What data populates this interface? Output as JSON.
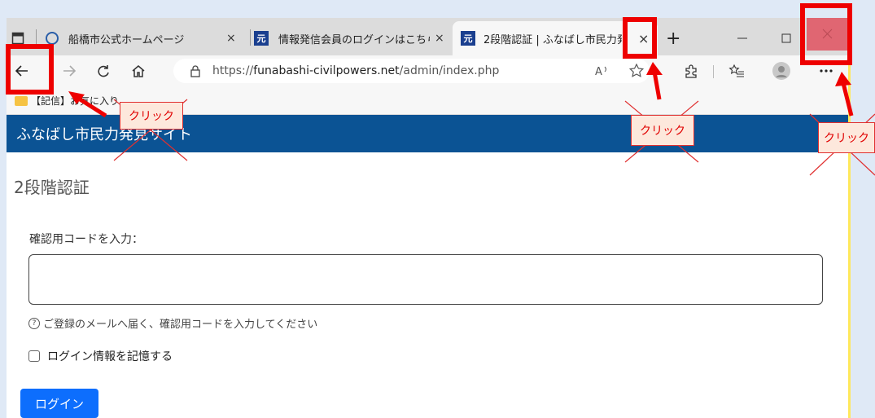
{
  "browser": {
    "tabs": [
      {
        "title": "船橋市公式ホームページ",
        "favicon": "globe-icon"
      },
      {
        "title": "情報発信会員のログインはこちら(",
        "favicon_text": "元"
      },
      {
        "title": "2段階認証 | ふなばし市民力発",
        "favicon_text": "元"
      }
    ],
    "close_glyph": "×",
    "new_tab_glyph": "+",
    "url_prefix": "https://",
    "url_domain": "funabashi-civilpowers.net",
    "url_path": "/admin/index.php",
    "bookmark": "【記信】お気に入り"
  },
  "page": {
    "site_title": "ふなばし市民力発見サイト",
    "heading": "2段階認証",
    "code_label": "確認用コードを入力：",
    "code_value": "",
    "help_text": "ご登録のメールへ届く、確認用コードを入力してください",
    "remember_label": "ログイン情報を記憶する",
    "remember_checked": false,
    "login_button": "ログイン"
  },
  "annotations": {
    "callout_text": "クリック",
    "highlight_color": "#ee0000",
    "accent_color": "#0d6efd",
    "header_color": "#0b5394"
  }
}
